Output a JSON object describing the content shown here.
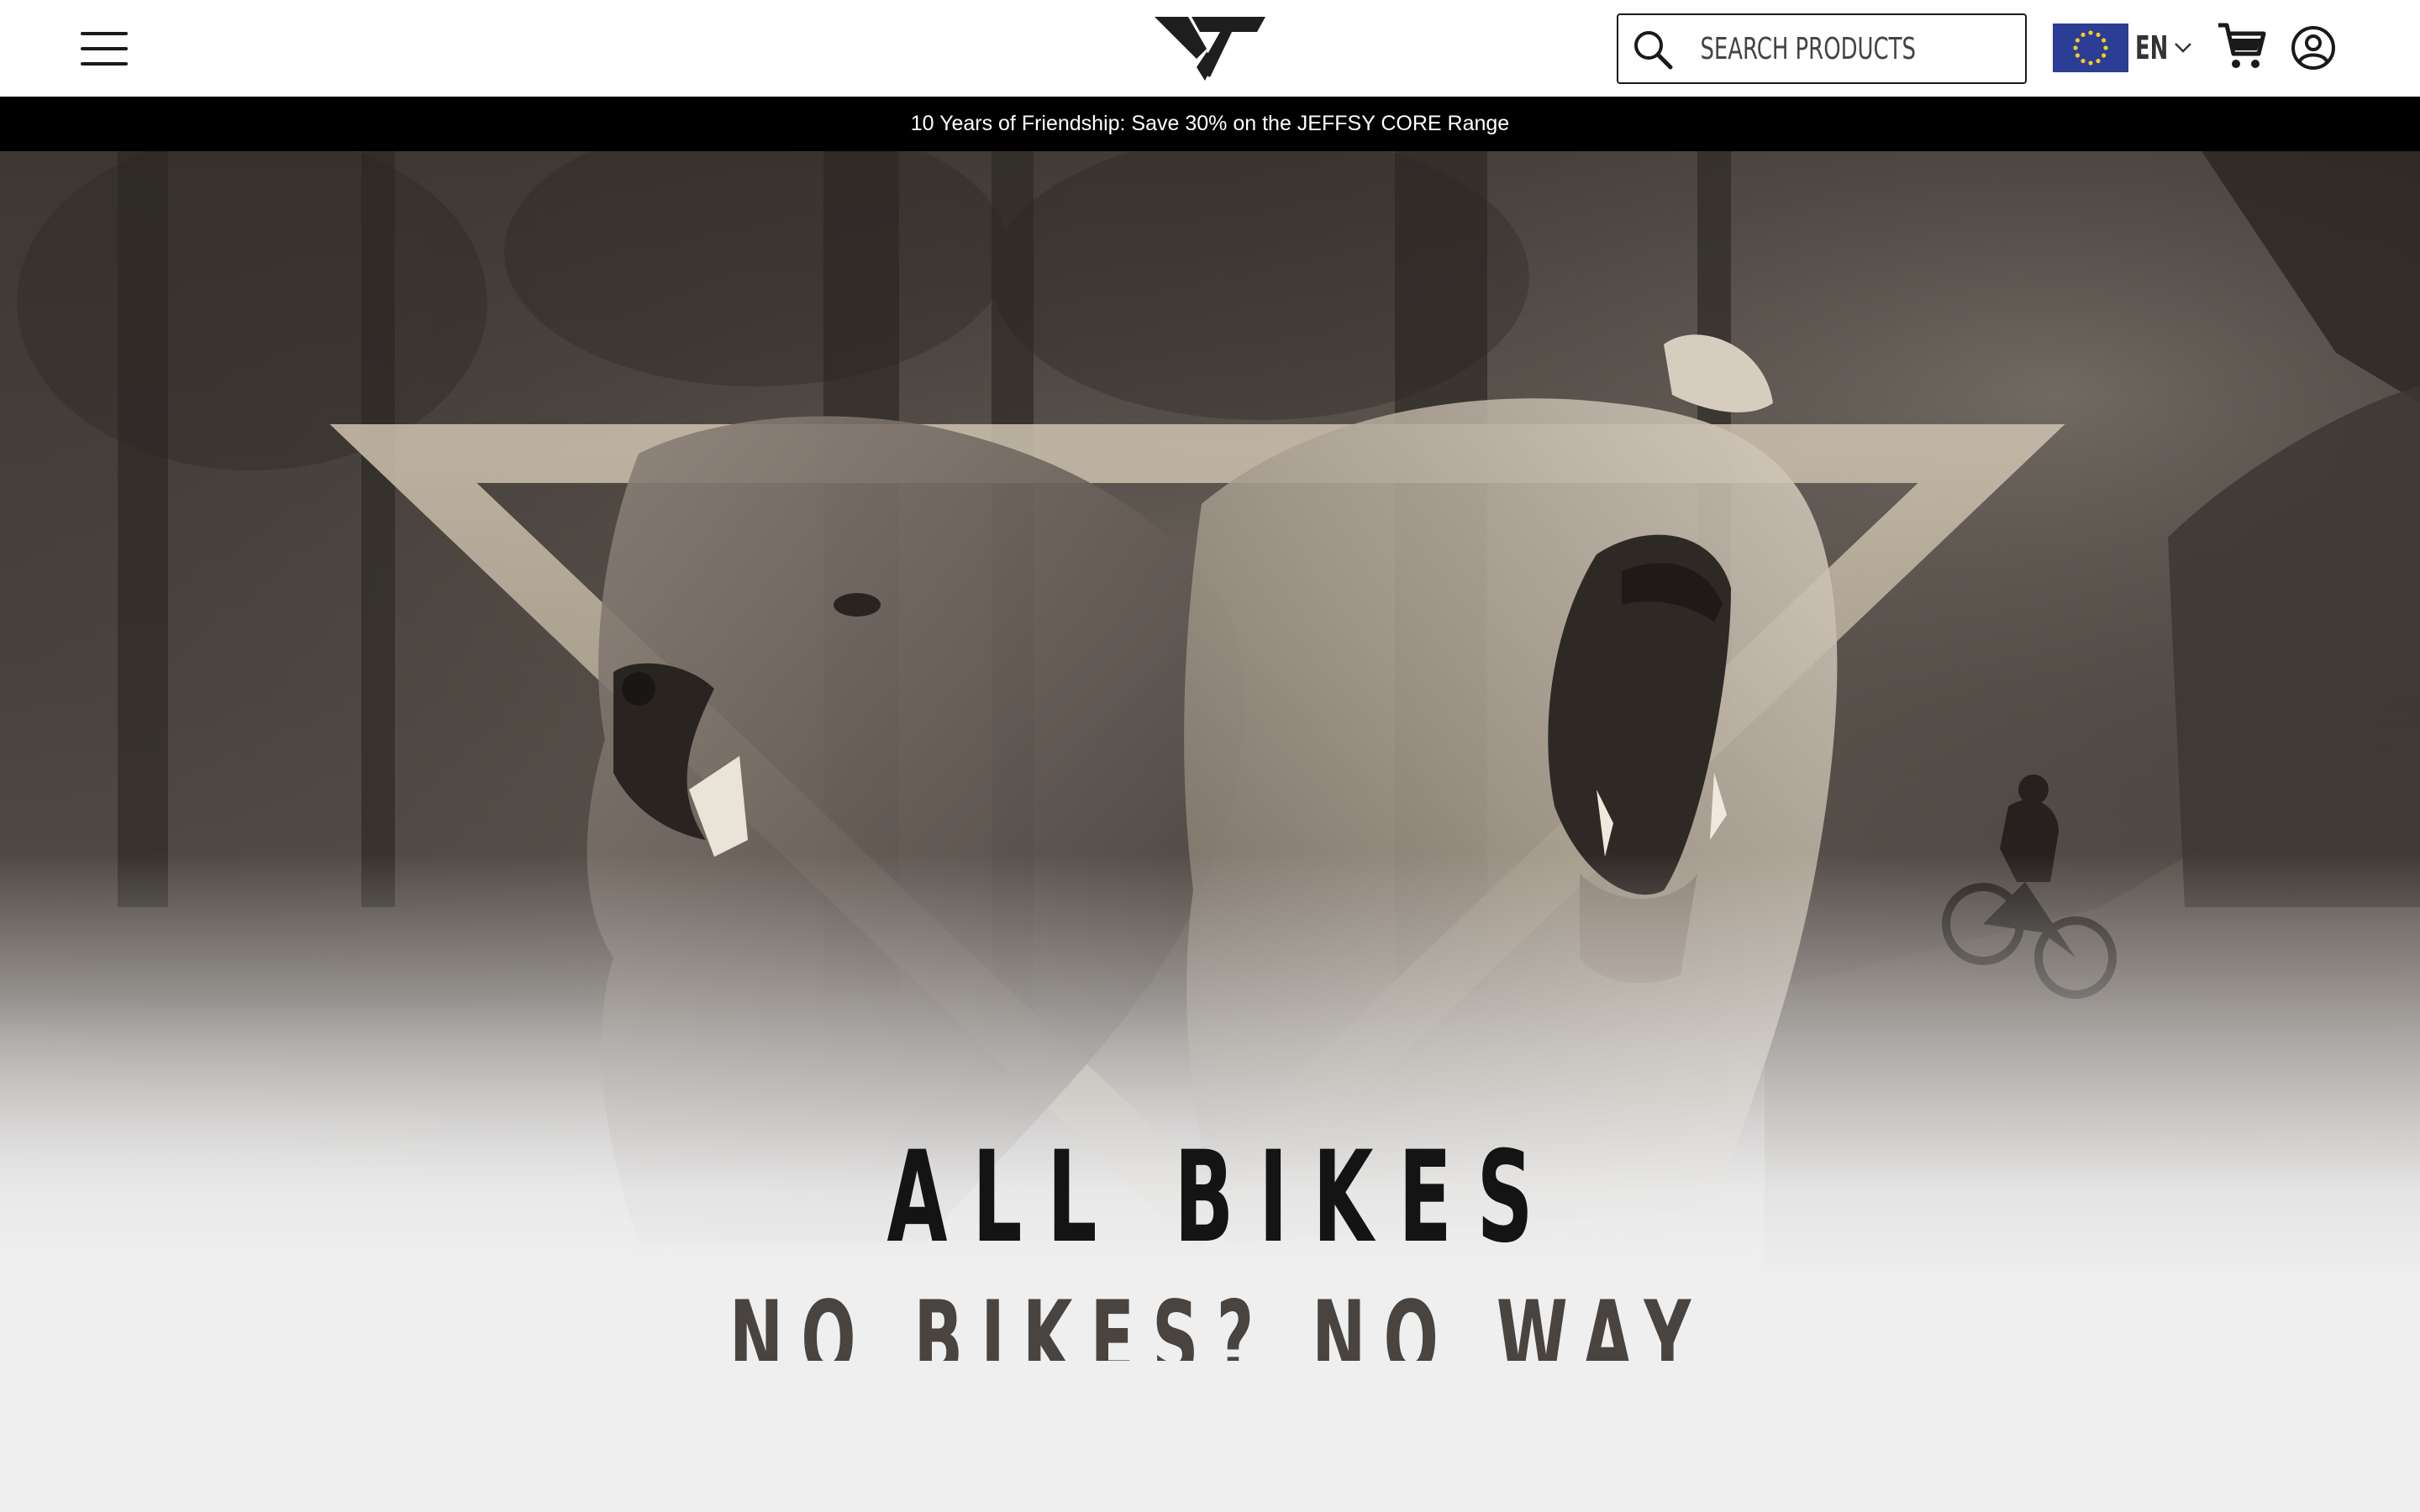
{
  "header": {
    "search": {
      "placeholder": "SEARCH PRODUCTS"
    },
    "language": {
      "code": "EN",
      "flag": "eu-flag-icon"
    },
    "icons": {
      "menu": "hamburger-menu-icon",
      "logo": "yt-logo",
      "search": "search-icon",
      "cart": "cart-icon",
      "account": "account-icon"
    }
  },
  "promo": {
    "text": "10 Years of Friendship: Save 30% on the JEFFSY CORE Range"
  },
  "hero": {
    "title": "ALL BIKES",
    "subtitle": "NO BIKES? NO WAY"
  },
  "colors": {
    "header_bg": "#ffffff",
    "promo_bg": "#000000",
    "promo_text": "#ffffff",
    "hero_title": "#141414",
    "hero_subtitle": "#4a4440",
    "page_bg": "#efefef",
    "eu_blue": "#2b3d95",
    "eu_gold": "#f5cc1c"
  }
}
